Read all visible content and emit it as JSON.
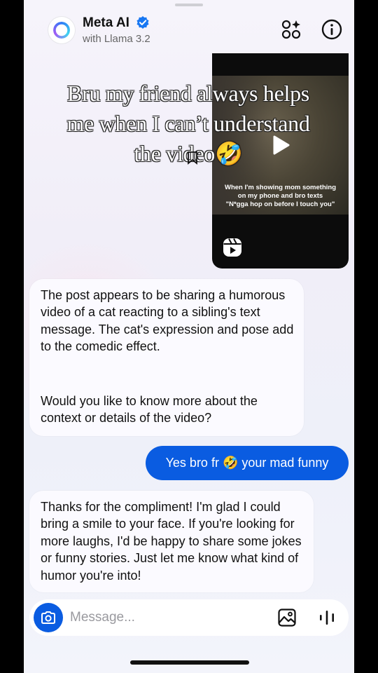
{
  "header": {
    "title": "Meta AI",
    "subtitle": "with Llama 3.2"
  },
  "video": {
    "caption_line1": "When I'm showing mom something",
    "caption_line2": "on my phone and bro texts",
    "caption_line3": "\"N*gga hop on before I touch you\""
  },
  "overlay": {
    "line1": "Bru my friend always helps",
    "line2": "me  when I can’t understand",
    "line3": "the video🤣"
  },
  "messages": {
    "ai1_p1": "The post appears to be sharing a humorous video of a cat reacting to a sibling's text message. The cat's expression and pose add to the comedic effect.",
    "ai1_p2": "Would you like to know more about the context or details of the video?",
    "user1": "Yes bro fr 🤣 your mad funny",
    "ai2": "Thanks for the compliment! I'm glad I could bring a smile to your face. If you're looking for more laughs, I'd be happy to share some jokes or funny stories. Just let me know what kind of humor you're into!"
  },
  "composer": {
    "placeholder": "Message..."
  },
  "colors": {
    "accent": "#0a5ce1",
    "background": "#f3f1f9"
  },
  "icons": [
    "meta-ai-avatar-icon",
    "verified-icon",
    "apps-sparkle-icon",
    "info-icon",
    "play-icon",
    "reels-icon",
    "camera-icon",
    "gallery-icon",
    "voice-icon"
  ]
}
